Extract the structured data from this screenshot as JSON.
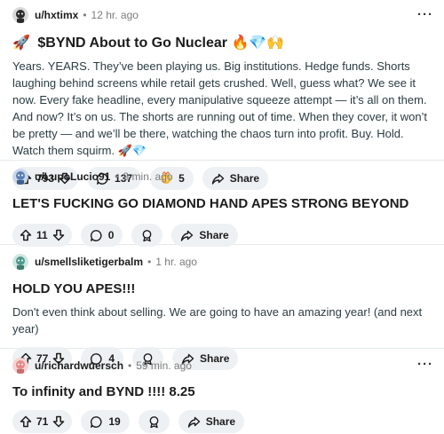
{
  "posts": [
    {
      "username": "u/hxtimx",
      "time": "12 hr. ago",
      "title_prefix": "🚀",
      "title": "$BYND About to Go Nuclear",
      "title_suffix": "🔥💎🙌",
      "body": "Years. YEARS. They’ve been playing us. Big institutions. Hedge funds. Shorts laughing behind screens while retail gets crushed. Well, guess what? We see it now. Every fake headline, every manipulative squeeze attempt — it’s all on them. And now? It’s on us. The shorts are running out of time. When they cover, it won’t be pretty — and we’ll be there, watching the chaos turn into profit. Buy. Hold. Watch them squirm.",
      "body_suffix": "🚀💎",
      "votes": "793",
      "comments": "137",
      "awards": "5",
      "share_label": "Share",
      "avatar_color": "#2b2b2b"
    },
    {
      "username": "u/LupoLucio91",
      "time": "9 min. ago",
      "title": "LET'S FUCKING GO DIAMOND HAND APES STRONG BEYOND",
      "votes": "11",
      "comments": "0",
      "share_label": "Share",
      "avatar_color": "#5a7fb5"
    },
    {
      "username": "u/smellsliketigerbalm",
      "time": "1 hr. ago",
      "title": "HOLD YOU APES!!!",
      "body": "Don't even think about selling. We are going to have an amazing year! (and next year)",
      "votes": "77",
      "comments": "4",
      "share_label": "Share",
      "avatar_color": "#4f9a8f"
    },
    {
      "username": "u/richardwuersch",
      "time": "59 min. ago",
      "title": "To infinity and BYND !!!! 8.25",
      "votes": "71",
      "comments": "19",
      "share_label": "Share",
      "avatar_color": "#e58a8a"
    }
  ],
  "more_glyph": "···",
  "separator": "•"
}
